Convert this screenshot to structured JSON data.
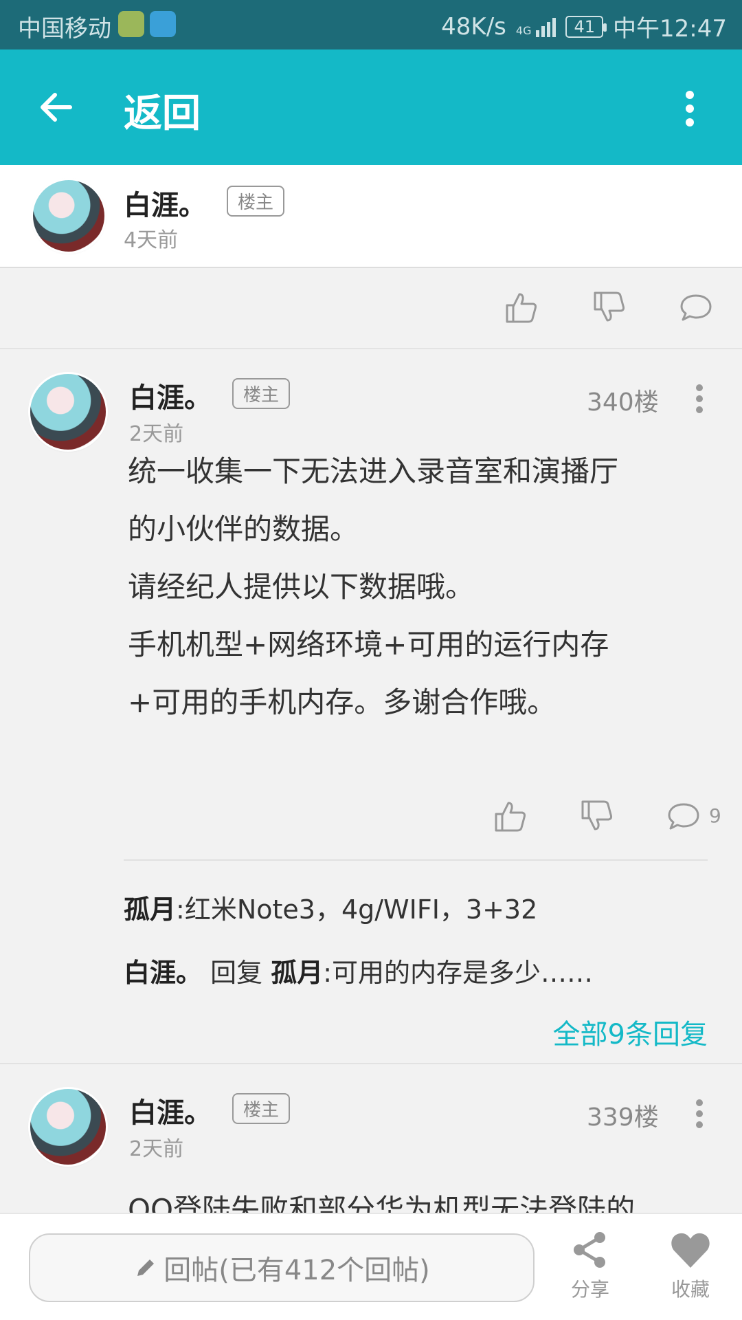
{
  "status_bar": {
    "carrier": "中国移动",
    "speed": "48K/s",
    "network": "4G",
    "battery": "41",
    "time": "中午12:47"
  },
  "app_bar": {
    "title": "返回"
  },
  "op": {
    "name": "白涯。",
    "badge": "楼主",
    "time": "4天前"
  },
  "posts": [
    {
      "name": "白涯。",
      "badge": "楼主",
      "time": "2天前",
      "floor": "340楼",
      "content": [
        "统一收集一下无法进入录音室和演播厅",
        "的小伙伴的数据。",
        "请经纪人提供以下数据哦。",
        "手机机型+网络环境+可用的运行内存",
        "+可用的手机内存。多谢合作哦。"
      ],
      "comment_count": "9",
      "replies": [
        {
          "user": "孤月",
          "sep": ":",
          "text": "红米Note3，4g/WIFI，3+32"
        },
        {
          "user": "白涯。",
          "mid": "回复",
          "target": "孤月",
          "sep": ":",
          "text": "可用的内存是多少……"
        }
      ],
      "all_replies": "全部9条回复"
    },
    {
      "name": "白涯。",
      "badge": "楼主",
      "time": "2天前",
      "floor": "339楼",
      "content_partial": "QQ登陆失败和部分华为机型无法登陆的"
    }
  ],
  "bottom_bar": {
    "reply_placeholder": "回帖(已有412个回帖)",
    "share": "分享",
    "favorite": "收藏"
  },
  "colors": {
    "accent": "#14b9c7",
    "status": "#1d6b78"
  }
}
